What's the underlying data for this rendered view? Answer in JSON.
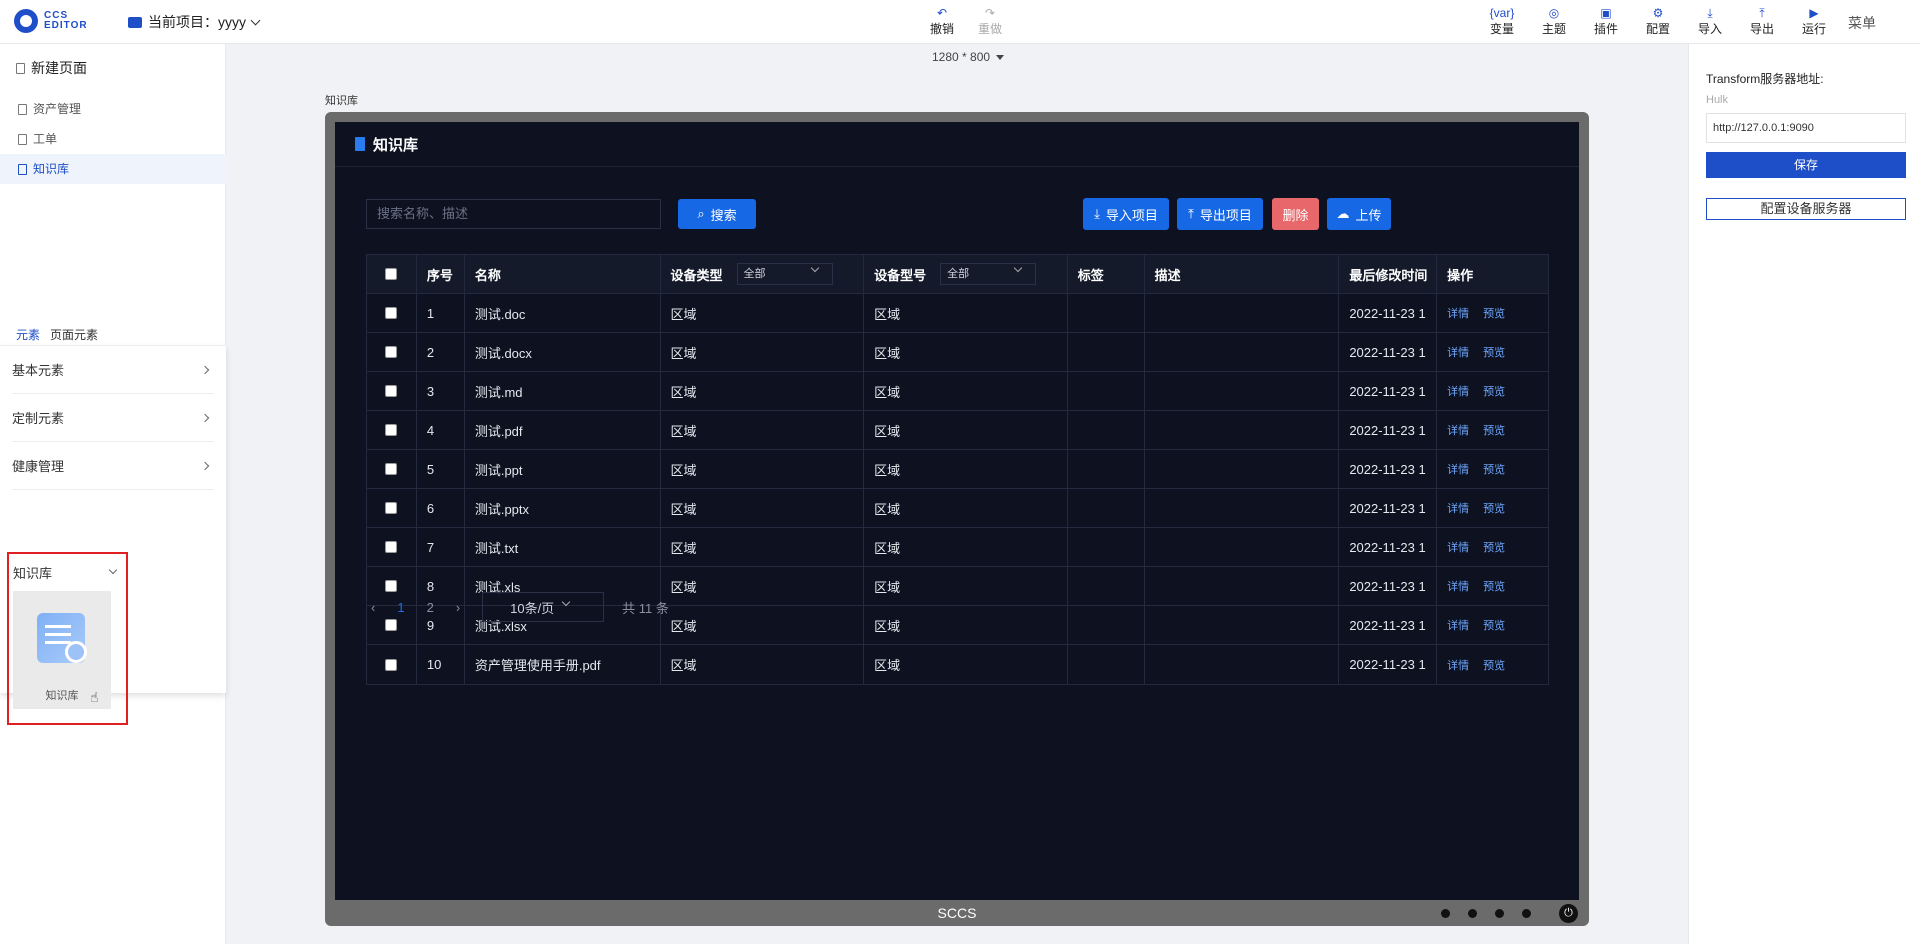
{
  "topbar": {
    "logo_text": "CCS EDITOR",
    "project_label": "当前项目：",
    "project_name": "yyyy",
    "center_tools": [
      {
        "label": "撤销",
        "icon": "undo-icon",
        "glyph": "↶",
        "enabled": true
      },
      {
        "label": "重做",
        "icon": "redo-icon",
        "glyph": "↷",
        "enabled": false
      }
    ],
    "right_tools": [
      {
        "label": "变量",
        "icon": "variable-icon",
        "glyph": "{var}"
      },
      {
        "label": "主题",
        "icon": "theme-icon",
        "glyph": "◎"
      },
      {
        "label": "插件",
        "icon": "plugin-icon",
        "glyph": "▣"
      },
      {
        "label": "配置",
        "icon": "settings-icon",
        "glyph": "⚙"
      },
      {
        "label": "导入",
        "icon": "import-icon",
        "glyph": "⤓"
      },
      {
        "label": "导出",
        "icon": "export-icon",
        "glyph": "⤒"
      },
      {
        "label": "运行",
        "icon": "run-icon",
        "glyph": "▶"
      }
    ],
    "menu_label": "菜单"
  },
  "left": {
    "new_page": "新建页面",
    "pages": [
      {
        "label": "资产管理",
        "active": false
      },
      {
        "label": "工单",
        "active": false
      },
      {
        "label": "知识库",
        "active": true
      }
    ],
    "tabs": [
      "元素",
      "页面元素"
    ],
    "categories": [
      "基本元素",
      "定制元素",
      "健康管理"
    ],
    "expanded_category": "知识库",
    "tile_label": "知识库"
  },
  "canvas": {
    "resolution": "1280 * 800",
    "label": "知识库",
    "device_title": "SCCS"
  },
  "screen": {
    "title": "知识库",
    "search_placeholder": "搜索名称、描述",
    "search_btn": "搜索",
    "import_btn": "导入项目",
    "export_btn": "导出项目",
    "delete_btn": "删除",
    "upload_btn": "上传",
    "headers": {
      "no": "序号",
      "name": "名称",
      "type": "设备类型",
      "model": "设备型号",
      "tag": "标签",
      "desc": "描述",
      "modified": "最后修改时间",
      "ops": "操作"
    },
    "type_filter": "全部",
    "model_filter": "全部",
    "rows": [
      {
        "no": "1",
        "name": "测试.doc",
        "type": "区域",
        "model": "区域",
        "tag": "",
        "desc": "",
        "modified": "2022-11-23 1"
      },
      {
        "no": "2",
        "name": "测试.docx",
        "type": "区域",
        "model": "区域",
        "tag": "",
        "desc": "",
        "modified": "2022-11-23 1"
      },
      {
        "no": "3",
        "name": "测试.md",
        "type": "区域",
        "model": "区域",
        "tag": "",
        "desc": "",
        "modified": "2022-11-23 1"
      },
      {
        "no": "4",
        "name": "测试.pdf",
        "type": "区域",
        "model": "区域",
        "tag": "",
        "desc": "",
        "modified": "2022-11-23 1"
      },
      {
        "no": "5",
        "name": "测试.ppt",
        "type": "区域",
        "model": "区域",
        "tag": "",
        "desc": "",
        "modified": "2022-11-23 1"
      },
      {
        "no": "6",
        "name": "测试.pptx",
        "type": "区域",
        "model": "区域",
        "tag": "",
        "desc": "",
        "modified": "2022-11-23 1"
      },
      {
        "no": "7",
        "name": "测试.txt",
        "type": "区域",
        "model": "区域",
        "tag": "",
        "desc": "",
        "modified": "2022-11-23 1"
      },
      {
        "no": "8",
        "name": "测试.xls",
        "type": "区域",
        "model": "区域",
        "tag": "",
        "desc": "",
        "modified": "2022-11-23 1"
      },
      {
        "no": "9",
        "name": "测试.xlsx",
        "type": "区域",
        "model": "区域",
        "tag": "",
        "desc": "",
        "modified": "2022-11-23 1"
      },
      {
        "no": "10",
        "name": "资产管理使用手册.pdf",
        "type": "区域",
        "model": "区域",
        "tag": "",
        "desc": "",
        "modified": "2022-11-23 1"
      }
    ],
    "op_detail": "详情",
    "op_preview": "预览",
    "pager": {
      "pages": [
        "1",
        "2"
      ],
      "current": "1",
      "page_size": "10条/页",
      "total": "共 11 条"
    }
  },
  "right": {
    "server_label": "Transform服务器地址:",
    "server_placeholder": "Hulk",
    "server_value": "http://127.0.0.1:9090",
    "save_btn": "保存",
    "config_btn": "配置设备服务器"
  }
}
